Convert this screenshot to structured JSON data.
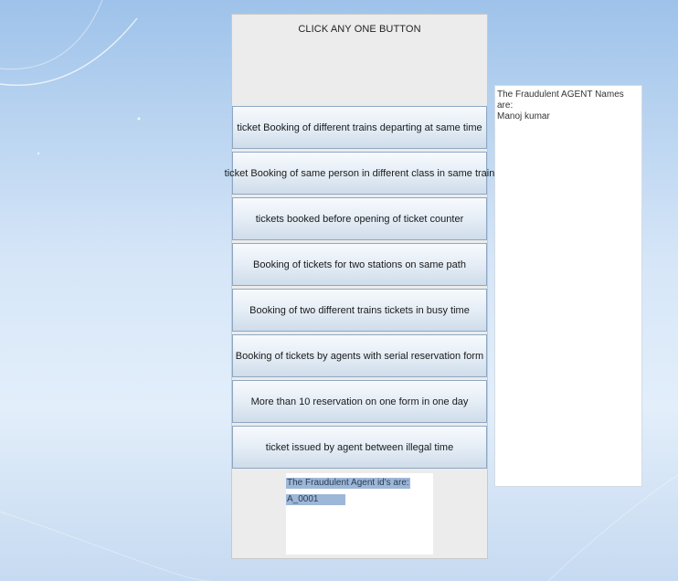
{
  "panel": {
    "title": "CLICK ANY ONE BUTTON",
    "buttons": [
      {
        "label": "ticket Booking of different trains departing at same time"
      },
      {
        "label": "ticket Booking of same person in different class in same train"
      },
      {
        "label": "tickets booked before opening of ticket counter"
      },
      {
        "label": "Booking of tickets for two stations on same path"
      },
      {
        "label": "Booking of two different trains tickets in busy time"
      },
      {
        "label": "Booking of tickets by agents with serial reservation form"
      },
      {
        "label": "More than 10 reservation on one form in one day"
      },
      {
        "label": "ticket issued by agent between illegal time"
      }
    ]
  },
  "agent_ids_output": {
    "heading": "The Fraudulent Agent id's are:",
    "value": "A_0001"
  },
  "agent_names_output": {
    "heading": "The Fraudulent AGENT Names are:",
    "value": "Manoj kumar"
  },
  "colors": {
    "desktop_top": "#9ec2ea",
    "desktop_bottom": "#c6daf1",
    "panel_bg": "#ececec",
    "selection_highlight": "#9db7d8"
  }
}
